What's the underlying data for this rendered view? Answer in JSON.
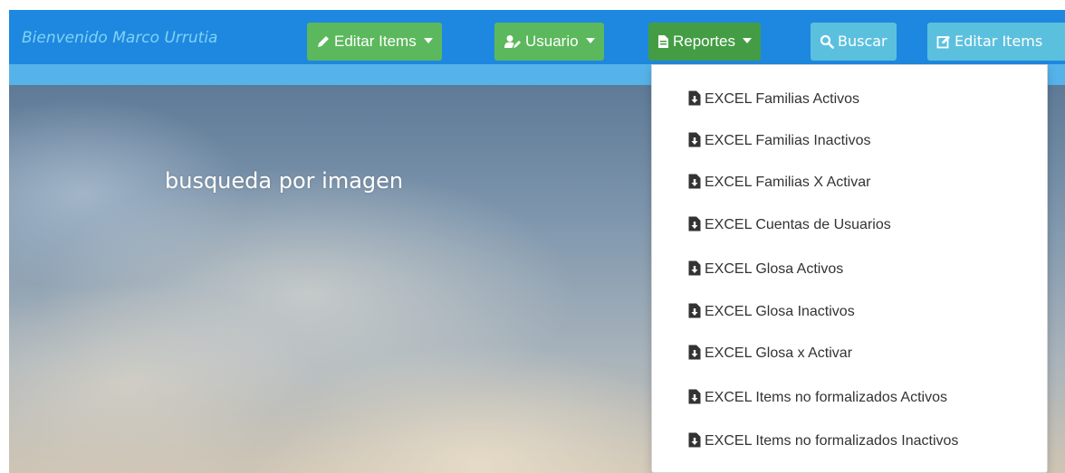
{
  "navbar": {
    "welcome": "Bienvenido Marco Urrutia",
    "buttons": {
      "editar_items": {
        "label": "Editar Items",
        "icon": "pencil-icon"
      },
      "usuario": {
        "label": "Usuario",
        "icon": "user-edit-icon"
      },
      "reportes": {
        "label": "Reportes",
        "icon": "document-icon"
      },
      "buscar": {
        "label": "Buscar",
        "icon": "search-icon"
      },
      "editar_items_2": {
        "label": "Editar Items",
        "icon": "edit-square-icon"
      }
    }
  },
  "hero": {
    "text": "busqueda por imagen"
  },
  "reportes_menu": {
    "items": [
      {
        "label": "EXCEL Familias Activos",
        "icon": "file-download-icon"
      },
      {
        "label": "EXCEL Familias Inactivos",
        "icon": "file-download-icon"
      },
      {
        "label": "EXCEL Familias X Activar",
        "icon": "file-download-icon"
      },
      {
        "label": "EXCEL Cuentas de Usuarios",
        "icon": "file-download-icon"
      },
      {
        "label": "EXCEL Glosa Activos",
        "icon": "file-download-icon"
      },
      {
        "label": "EXCEL Glosa Inactivos",
        "icon": "file-download-icon"
      },
      {
        "label": "EXCEL Glosa x Activar",
        "icon": "file-download-icon"
      },
      {
        "label": "EXCEL Items no formalizados Activos",
        "icon": "file-download-icon"
      },
      {
        "label": "EXCEL Items no formalizados Inactivos",
        "icon": "file-download-icon"
      }
    ]
  },
  "colors": {
    "navbar": "#1e88e0",
    "navbar_strip": "#56b3ea",
    "welcome_text": "#7fd3f4",
    "btn_success": "#5cb85c",
    "btn_success_active": "#449d44",
    "btn_info": "#5bc0de"
  }
}
